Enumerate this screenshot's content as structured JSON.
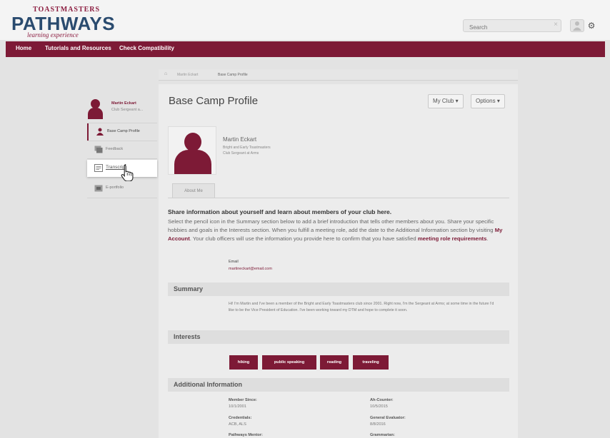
{
  "brand": {
    "org": "TOASTMASTERS",
    "name": "PATHWAYS",
    "tagline": "learning experience"
  },
  "header": {
    "search_placeholder": "Search"
  },
  "nav": {
    "items": [
      {
        "label": "Home"
      },
      {
        "label": "Tutorials and Resources"
      },
      {
        "label": "Check Compatibility"
      }
    ]
  },
  "breadcrumb": {
    "items": [
      "Martin Eckart",
      "Base Camp Profile"
    ]
  },
  "sidebar": {
    "user_name": "Martin Eckart",
    "user_role": "Club Sergeant a...",
    "items": [
      {
        "label": "Base Camp Profile"
      },
      {
        "label": "Feedback"
      },
      {
        "label": "Transcript"
      },
      {
        "label": "E-portfolio"
      }
    ]
  },
  "page": {
    "title": "Base Camp Profile",
    "my_club_label": "My Club",
    "options_label": "Options"
  },
  "profile": {
    "name": "Martin Eckart",
    "club": "Bright and Early Toastmasters",
    "role": "Club Sergeant at Arms",
    "tab_about": "About Me"
  },
  "share": {
    "title": "Share information about yourself and learn about members of your club here.",
    "text_1": "Select the pencil icon in the Summary section below to add a brief introduction that tells other members about you. Share your specific hobbies and goals in the Interests section. When you fulfill a meeting role, add the date to the Additional Information section by visiting ",
    "link_1": "My Account",
    "text_2": ". Your club officers will use the information you provide here to confirm that you have satisfied ",
    "link_2": "meeting role requirements",
    "text_3": "."
  },
  "email": {
    "label": "Email",
    "value": "martineckart@email.com"
  },
  "summary": {
    "heading": "Summary",
    "text": "Hi! I'm Martin and I've been a member of the Bright and Early Toastmasters club since 2001. Right now, I'm the Sergeant at Arms; at some time in the future I'd like to be the Vice President of Education. I've been working toward my DTM and hope to complete it soon."
  },
  "interests": {
    "heading": "Interests",
    "chips": [
      "hiking",
      "public speaking",
      "reading",
      "traveling"
    ]
  },
  "additional": {
    "heading": "Additional Information",
    "fields": [
      {
        "label": "Member Since:",
        "value": "10/1/2001"
      },
      {
        "label": "Ah-Counter:",
        "value": "10/5/2015"
      },
      {
        "label": "Credentials:",
        "value": "ACB, ALS"
      },
      {
        "label": "General Evaluator:",
        "value": "8/8/2016"
      },
      {
        "label": "Pathways Mentor:",
        "value": ""
      },
      {
        "label": "Grammarian:",
        "value": ""
      }
    ]
  },
  "colors": {
    "brand": "#7d1a36",
    "navy": "#2a4b6f"
  }
}
